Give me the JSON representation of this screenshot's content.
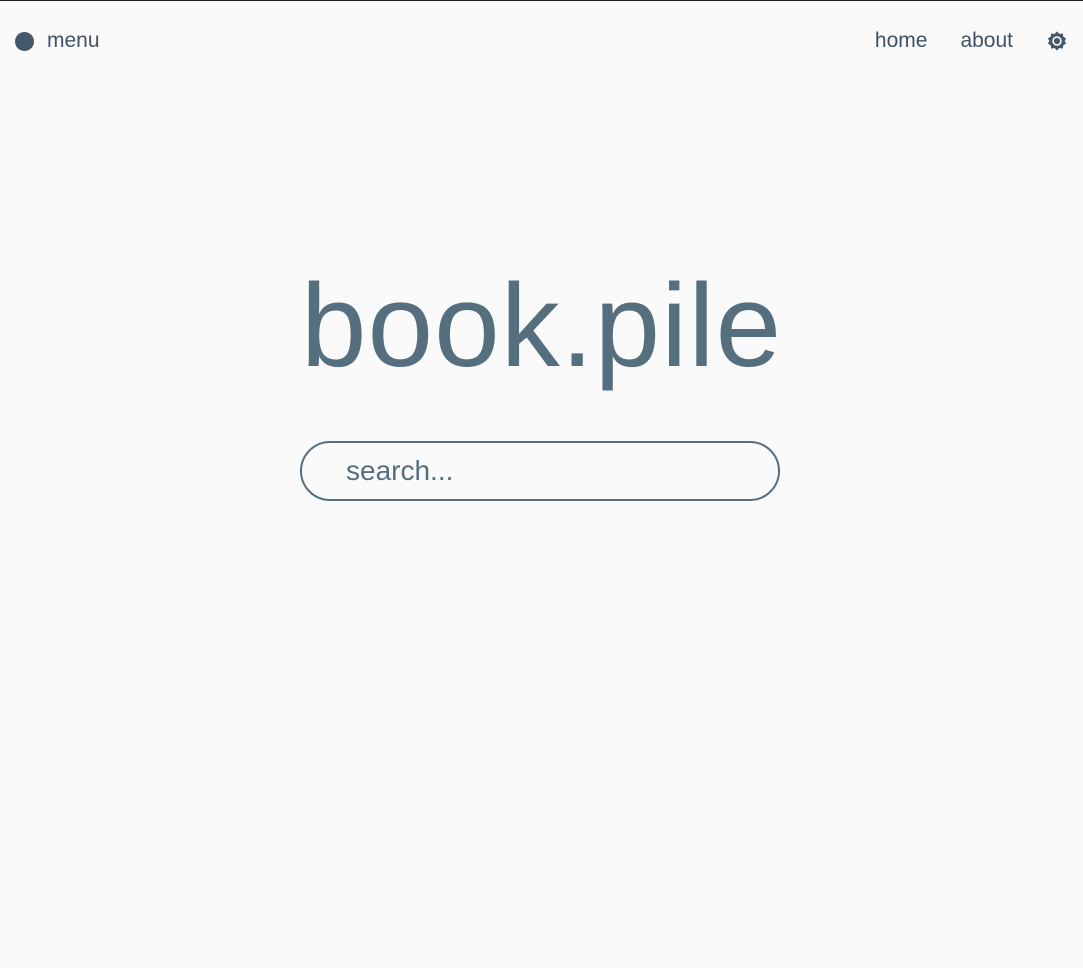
{
  "nav": {
    "menu_label": "menu",
    "links": [
      {
        "label": "home"
      },
      {
        "label": "about"
      }
    ],
    "theme_icon": "sun-gear-icon"
  },
  "hero": {
    "title": "book.pile"
  },
  "search": {
    "placeholder": "search...",
    "value": ""
  },
  "colors": {
    "background": "#fafafa",
    "text": "#3f5364",
    "accent": "#566f7e"
  }
}
